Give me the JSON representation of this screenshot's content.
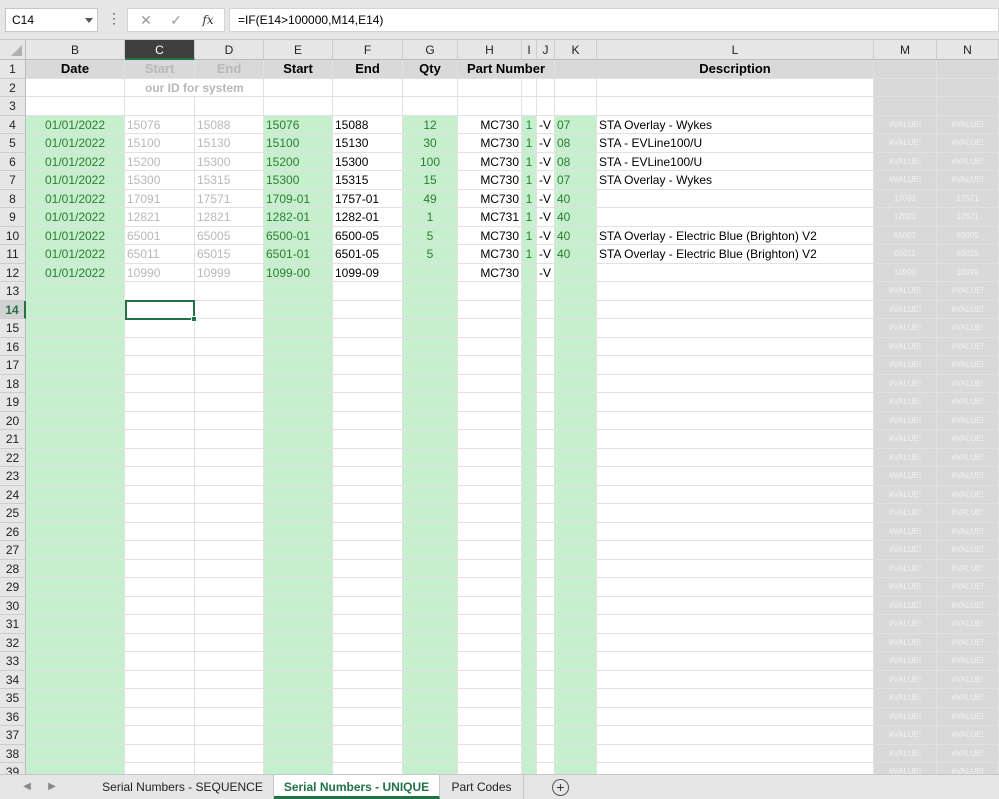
{
  "formula_bar": {
    "name_box": "C14",
    "cancel_icon": "cancel-icon",
    "enter_icon": "enter-icon",
    "fx_label": "fx",
    "formula": "=IF(E14>100000,M14,E14)"
  },
  "columns": [
    "B",
    "C",
    "D",
    "E",
    "F",
    "G",
    "H",
    "I",
    "J",
    "K",
    "L",
    "M",
    "N"
  ],
  "selected_cell": "C14",
  "header_row1": {
    "B": "Date",
    "C": "Start",
    "D": "End",
    "E": "Start",
    "F": "End",
    "G": "Qty",
    "H": "Part Number",
    "L": "Description"
  },
  "header_row2": {
    "C": "our ID for system"
  },
  "data_rows": [
    {
      "row": "4",
      "B": "01/01/2022",
      "C": "15076",
      "D": "15088",
      "E": "15076",
      "F": "15088",
      "G": "12",
      "H": "MC730",
      "I": "1",
      "J": "-V",
      "K": "07",
      "L": "STA Overlay - Wykes",
      "M": "#VALUE!",
      "N": "#VALUE!"
    },
    {
      "row": "5",
      "B": "01/01/2022",
      "C": "15100",
      "D": "15130",
      "E": "15100",
      "F": "15130",
      "G": "30",
      "H": "MC730",
      "I": "1",
      "J": "-V",
      "K": "08",
      "L": "STA - EVLine100/U",
      "M": "#VALUE!",
      "N": "#VALUE!"
    },
    {
      "row": "6",
      "B": "01/01/2022",
      "C": "15200",
      "D": "15300",
      "E": "15200",
      "F": "15300",
      "G": "100",
      "H": "MC730",
      "I": "1",
      "J": "-V",
      "K": "08",
      "L": "STA - EVLine100/U",
      "M": "#VALUE!",
      "N": "#VALUE!"
    },
    {
      "row": "7",
      "B": "01/01/2022",
      "C": "15300",
      "D": "15315",
      "E": "15300",
      "F": "15315",
      "G": "15",
      "H": "MC730",
      "I": "1",
      "J": "-V",
      "K": "07",
      "L": "STA Overlay - Wykes",
      "M": "#VALUE!",
      "N": "#VALUE!"
    },
    {
      "row": "8",
      "B": "01/01/2022",
      "C": "17091",
      "D": "17571",
      "E": "1709-01",
      "F": "1757-01",
      "G": "49",
      "H": "MC730",
      "I": "1",
      "J": "-V",
      "K": "40",
      "L": "",
      "M": "17091",
      "N": "17571"
    },
    {
      "row": "9",
      "B": "01/01/2022",
      "C": "12821",
      "D": "12821",
      "E": "1282-01",
      "F": "1282-01",
      "G": "1",
      "H": "MC731",
      "I": "1",
      "J": "-V",
      "K": "40",
      "L": "",
      "M": "12821",
      "N": "12821"
    },
    {
      "row": "10",
      "B": "01/01/2022",
      "C": "65001",
      "D": "65005",
      "E": "6500-01",
      "F": "6500-05",
      "G": "5",
      "H": "MC730",
      "I": "1",
      "J": "-V",
      "K": "40",
      "L": "STA Overlay - Electric Blue (Brighton) V2",
      "M": "65001",
      "N": "65005"
    },
    {
      "row": "11",
      "B": "01/01/2022",
      "C": "65011",
      "D": "65015",
      "E": "6501-01",
      "F": "6501-05",
      "G": "5",
      "H": "MC730",
      "I": "1",
      "J": "-V",
      "K": "40",
      "L": "STA Overlay - Electric Blue (Brighton) V2",
      "M": "65011",
      "N": "65015"
    },
    {
      "row": "12",
      "B": "01/01/2022",
      "C": "10990",
      "D": "10999",
      "E": "1099-00",
      "F": "1099-09",
      "G": "",
      "H": "MC730",
      "I": "",
      "J": "-V",
      "K": "",
      "L": "",
      "M": "10990",
      "N": "10999"
    }
  ],
  "empty_rows": [
    "13",
    "14",
    "15",
    "16",
    "17",
    "18",
    "19",
    "20",
    "21",
    "22",
    "23",
    "24",
    "25",
    "26",
    "27",
    "28",
    "29",
    "30",
    "31",
    "32",
    "33",
    "34",
    "35",
    "36",
    "37",
    "38",
    "39"
  ],
  "empty_row_value": "#VALUE!",
  "sheet_tabs": {
    "prev_icon": "scroll-left-icon",
    "next_icon": "scroll-right-icon",
    "tabs": [
      "Serial Numbers - SEQUENCE",
      "Serial Numbers - UNIQUE",
      "Part Codes"
    ],
    "active": "Serial Numbers - UNIQUE",
    "add_icon": "add-sheet-icon"
  },
  "colors": {
    "green_fill": "#c6efce",
    "grey_fill": "#d9d9d9",
    "excel_green": "#217346"
  }
}
